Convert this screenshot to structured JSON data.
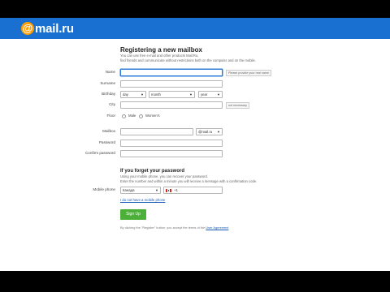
{
  "header": {
    "logo_text": "mail.ru"
  },
  "form": {
    "title": "Registering a new mailbox",
    "intro_line1": "You can use free e-mail and other products Mail.Ru,",
    "intro_line2": "find friends and communicate without restrictions both on the computer and on the mobile.",
    "name": {
      "label": "Name",
      "hint": "Please provide your real name"
    },
    "surname": {
      "label": "Surname"
    },
    "birthday": {
      "label": "Birthday",
      "day": "day",
      "month": "month",
      "year": "year"
    },
    "city": {
      "label": "City",
      "hint": "not necessary"
    },
    "gender": {
      "label": "Floor",
      "option_male": "Male",
      "option_female": "Women's"
    },
    "mailbox": {
      "label": "Mailbox",
      "at_symbol": "@",
      "domain": "mail.ru"
    },
    "password": {
      "label": "Password"
    },
    "confirm_password": {
      "label": "Confirm password"
    },
    "recovery": {
      "heading": "If you forget your password",
      "line1": "Using your mobile phone, you can recover your password.",
      "line2": "Enter the number and within a minute you will receive a message with a confirmation code."
    },
    "phone": {
      "label": "Mobile phone",
      "country": "Канада",
      "prefix": "+1",
      "no_phone_link": "I do not have a mobile phone"
    },
    "submit_label": "Sign Up",
    "terms_prefix": "By clicking the \"Register\" button, you accept the terms of the",
    "terms_link": "User Agreement"
  },
  "colors": {
    "header_blue": "#1a70d0",
    "logo_orange": "#ff9e00",
    "button_green": "#4caf3a",
    "link_blue": "#1a5bb5"
  }
}
